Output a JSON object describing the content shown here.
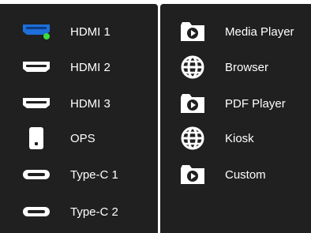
{
  "sources": [
    {
      "label": "HDMI 1",
      "icon": "hdmi-port-icon",
      "active": true
    },
    {
      "label": "HDMI 2",
      "icon": "hdmi-port-icon"
    },
    {
      "label": "HDMI 3",
      "icon": "hdmi-port-icon"
    },
    {
      "label": "OPS",
      "icon": "ops-module-icon"
    },
    {
      "label": "Type-C 1",
      "icon": "usb-c-port-icon"
    },
    {
      "label": "Type-C 2",
      "icon": "usb-c-port-icon"
    }
  ],
  "apps": [
    {
      "label": "Media Player",
      "icon": "media-player-icon"
    },
    {
      "label": "Browser",
      "icon": "globe-icon"
    },
    {
      "label": "PDF Player",
      "icon": "pdf-player-icon"
    },
    {
      "label": "Kiosk",
      "icon": "globe-icon"
    },
    {
      "label": "Custom",
      "icon": "folder-play-icon"
    }
  ],
  "colors": {
    "panel_bg": "#202020",
    "active_source": "#1e6fd9",
    "active_indicator": "#3ddc3d",
    "foreground": "#ffffff"
  }
}
